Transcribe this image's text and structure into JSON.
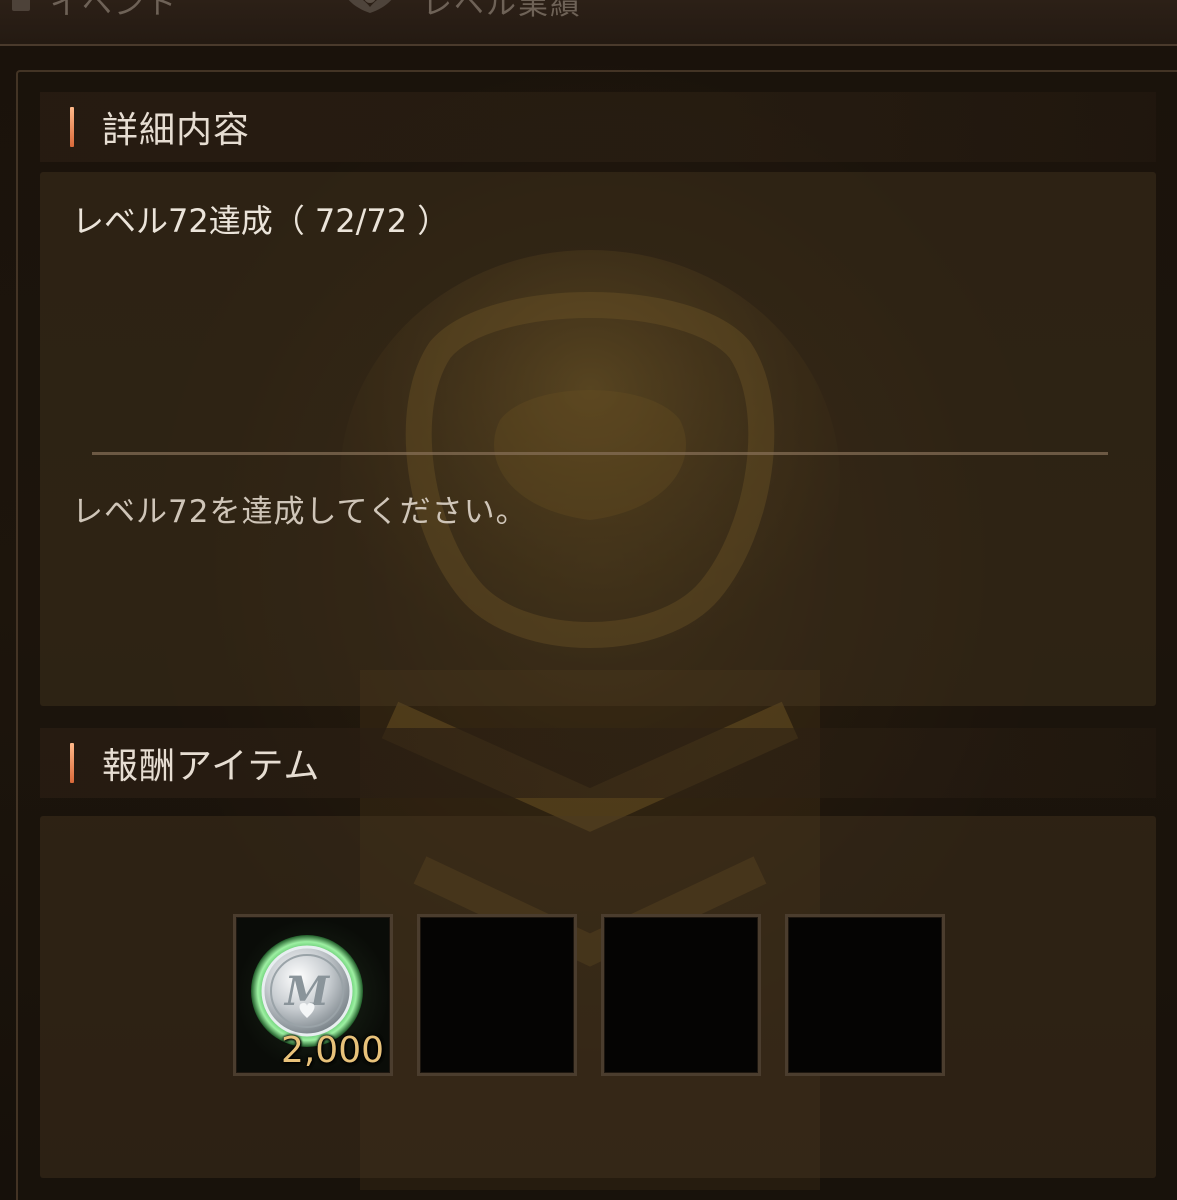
{
  "topbar": {
    "tabs": [
      {
        "label": "イベント",
        "icon": "bar-icon"
      },
      {
        "label": "レベル業績",
        "icon": "leaf-emblem-icon"
      }
    ]
  },
  "detail": {
    "header": "詳細内容",
    "goal": "レベル72達成（ 72/72 ）",
    "progress": {
      "current": 72,
      "total": 72
    },
    "description": "レベル72を達成してください。"
  },
  "rewards": {
    "header": "報酬アイテム",
    "items": [
      {
        "icon": "m-coin-icon",
        "quantity": "2,000"
      },
      {
        "icon": "empty-slot",
        "quantity": ""
      },
      {
        "icon": "empty-slot",
        "quantity": ""
      },
      {
        "icon": "empty-slot",
        "quantity": ""
      }
    ]
  },
  "colors": {
    "accent": "#d9693a",
    "quantity": "#e8c27a",
    "text": "#ebe4da"
  }
}
